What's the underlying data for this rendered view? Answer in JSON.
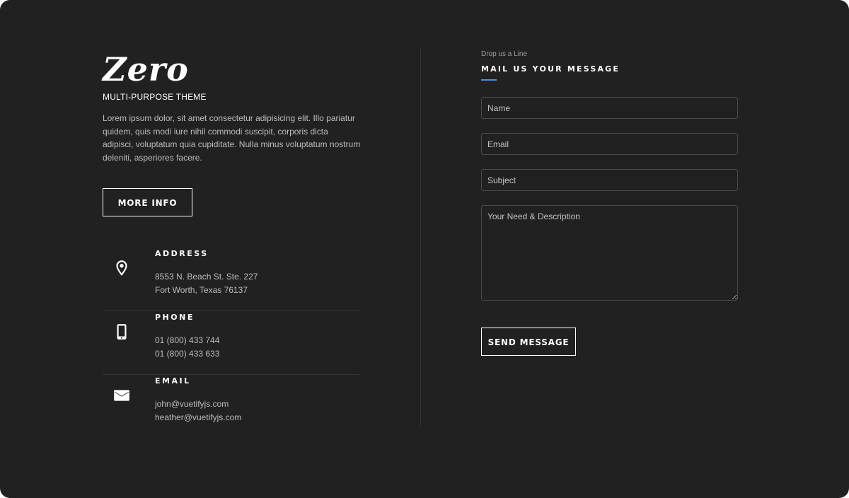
{
  "brand": {
    "logo_text": "Zero",
    "tagline": "MULTI-PURPOSE THEME",
    "intro": "Lorem ipsum dolor, sit amet consectetur adipisicing elit. Illo pariatur quidem, quis modi iure nihil commodi suscipit, corporis dicta adipisci, voluptatum quia cupiditate. Nulla minus voluptatum nostrum deleniti, asperiores facere.",
    "more_label": "MORE INFO"
  },
  "contacts": [
    {
      "icon": "map-pin-icon",
      "title": "ADDRESS",
      "line1": "8553 N. Beach St. Ste. 227",
      "line2": "Fort Worth, Texas 76137"
    },
    {
      "icon": "smartphone-icon",
      "title": "PHONE",
      "line1": "01 (800) 433 744",
      "line2": "01 (800) 433 633"
    },
    {
      "icon": "mail-icon",
      "title": "EMAIL",
      "line1": "john@vuetifyjs.com",
      "line2": "heather@vuetifyjs.com"
    }
  ],
  "form": {
    "eyebrow": "Drop us a Line",
    "title": "MAIL US YOUR MESSAGE",
    "name_placeholder": "Name",
    "email_placeholder": "Email",
    "subject_placeholder": "Subject",
    "message_placeholder": "Your Need & Description",
    "send_label": "SEND MESSAGE"
  },
  "colors": {
    "background": "#212121",
    "accent": "#4a90e2",
    "text_primary": "#ffffff",
    "text_secondary": "#bdbdbd"
  }
}
